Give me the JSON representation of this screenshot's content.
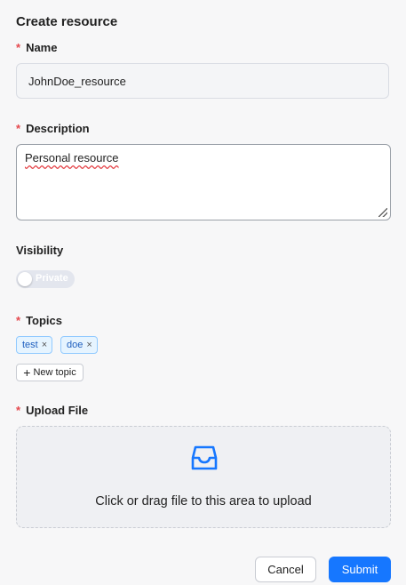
{
  "form": {
    "title": "Create resource",
    "name": {
      "required_mark": "*",
      "label": "Name",
      "value": "JohnDoe_resource"
    },
    "description": {
      "required_mark": "*",
      "label": "Description",
      "value": "Personal resource"
    },
    "visibility": {
      "label": "Visibility",
      "toggle_text": "Private",
      "on": false
    },
    "topics": {
      "required_mark": "*",
      "label": "Topics",
      "tags": [
        {
          "text": "test"
        },
        {
          "text": "doe"
        }
      ],
      "new_topic_label": "New topic",
      "tag_close_glyph": "×",
      "plus_glyph": "+"
    },
    "upload": {
      "required_mark": "*",
      "label": "Upload File",
      "icon": "inbox-icon",
      "hint": "Click or drag file to this area to upload"
    },
    "actions": {
      "cancel_label": "Cancel",
      "submit_label": "Submit"
    }
  },
  "colors": {
    "primary": "#1677ff",
    "required": "#e5484d",
    "tag_bg": "#e6f4ff",
    "tag_border": "#91caff"
  }
}
